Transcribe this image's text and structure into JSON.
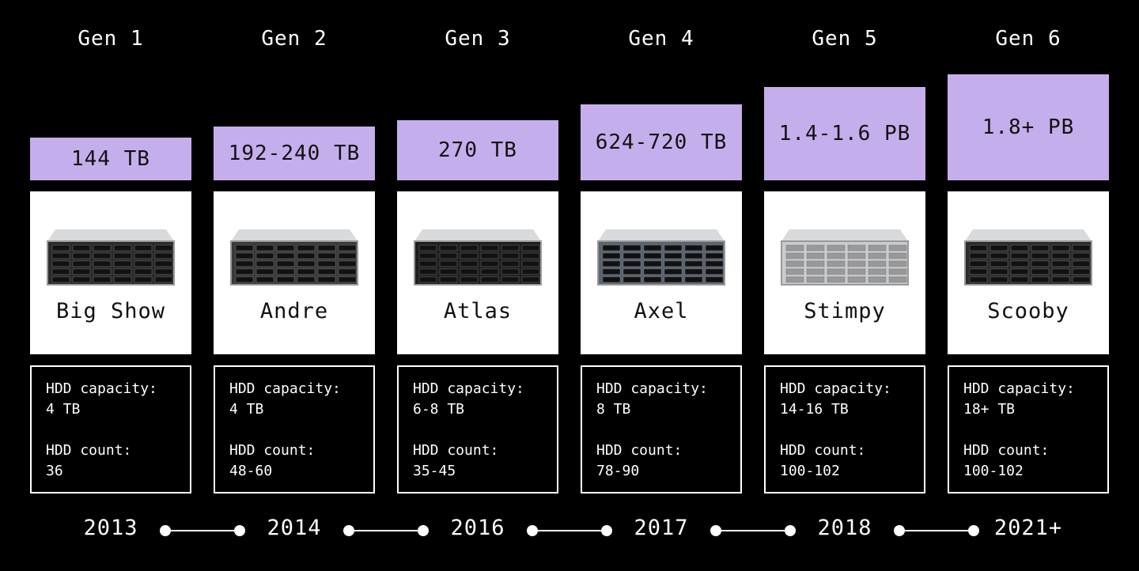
{
  "accent_color": "#c5aeec",
  "generations": [
    {
      "gen": "Gen 1",
      "capacity": "144 TB",
      "capacity_level": 1,
      "name": "Big Show",
      "hdd_capacity_label": "HDD capacity:",
      "hdd_capacity": "4 TB",
      "hdd_count_label": "HDD count:",
      "hdd_count": "36",
      "year": "2013",
      "image": "server-chassis-image"
    },
    {
      "gen": "Gen 2",
      "capacity": "192-240 TB",
      "capacity_level": 2,
      "name": "Andre",
      "hdd_capacity_label": "HDD capacity:",
      "hdd_capacity": "4 TB",
      "hdd_count_label": "HDD count:",
      "hdd_count": "48-60",
      "year": "2014",
      "image": "server-chassis-image"
    },
    {
      "gen": "Gen 3",
      "capacity": "270 TB",
      "capacity_level": 3,
      "name": "Atlas",
      "hdd_capacity_label": "HDD capacity:",
      "hdd_capacity": "6-8 TB",
      "hdd_count_label": "HDD count:",
      "hdd_count": "35-45",
      "year": "2016",
      "image": "server-chassis-image"
    },
    {
      "gen": "Gen 4",
      "capacity": "624-720 TB",
      "capacity_level": 4,
      "name": "Axel",
      "hdd_capacity_label": "HDD capacity:",
      "hdd_capacity": "8 TB",
      "hdd_count_label": "HDD count:",
      "hdd_count": "78-90",
      "year": "2017",
      "image": "server-chassis-image"
    },
    {
      "gen": "Gen 5",
      "capacity": "1.4-1.6 PB",
      "capacity_level": 5,
      "name": "Stimpy",
      "hdd_capacity_label": "HDD capacity:",
      "hdd_capacity": "14-16 TB",
      "hdd_count_label": "HDD count:",
      "hdd_count": "100-102",
      "year": "2018",
      "image": "server-chassis-image"
    },
    {
      "gen": "Gen 6",
      "capacity": "1.8+ PB",
      "capacity_level": 6,
      "name": "Scooby",
      "hdd_capacity_label": "HDD capacity:",
      "hdd_capacity": "18+ TB",
      "hdd_count_label": "HDD count:",
      "hdd_count": "100-102",
      "year": "2021+",
      "image": "server-chassis-image"
    }
  ]
}
